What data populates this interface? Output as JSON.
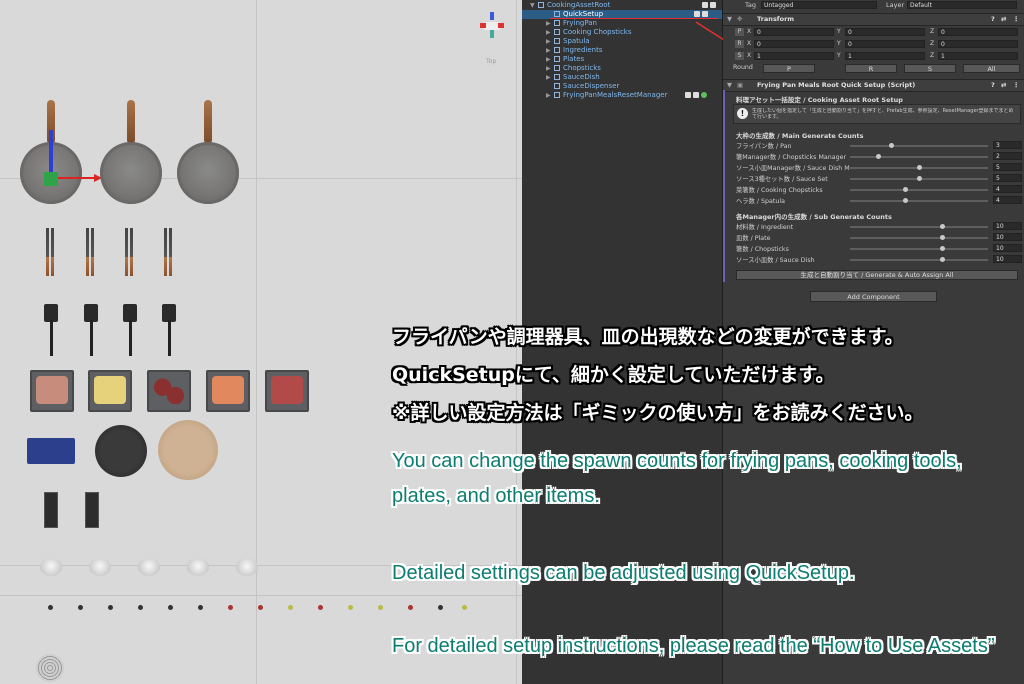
{
  "scene": {
    "gizmo_label": "Top"
  },
  "hierarchy": {
    "items": [
      {
        "label": "CookingAssetRoot"
      },
      {
        "label": "QuickSetup"
      },
      {
        "label": "FryingPan"
      },
      {
        "label": "Cooking Chopsticks"
      },
      {
        "label": "Spatula"
      },
      {
        "label": "Ingredients"
      },
      {
        "label": "Plates"
      },
      {
        "label": "Chopsticks"
      },
      {
        "label": "SauceDish"
      },
      {
        "label": "SauceDispenser"
      },
      {
        "label": "FryingPanMealsResetManager"
      }
    ]
  },
  "inspector": {
    "tag_label": "Tag",
    "tag_value": "Untagged",
    "layer_label": "Layer",
    "layer_value": "Default",
    "transform": {
      "title": "Transform",
      "rows": [
        {
          "key": "P",
          "x": "0",
          "y": "0",
          "z": "0"
        },
        {
          "key": "R",
          "x": "0",
          "y": "0",
          "z": "0"
        },
        {
          "key": "S",
          "x": "1",
          "y": "1",
          "z": "1"
        }
      ],
      "axis_x": "X",
      "axis_y": "Y",
      "axis_z": "Z",
      "round_label": "Round",
      "round_buttons": [
        "P",
        "R",
        "S",
        "All"
      ]
    },
    "script": {
      "title": "Frying Pan Meals Root Quick Setup (Script)",
      "section_root": "料理アセット一括設定 / Cooking Asset Root Setup",
      "info_text": "生成したい個を指定して「生成と自動割り当て」を押すと、Prefab生成、参照設定、ResetManager登録までまとめて行います。",
      "section_main": "大枠の生成数 / Main Generate Counts",
      "main_counts": [
        {
          "label": "フライパン数 / Pan",
          "value": 3,
          "max": 10
        },
        {
          "label": "箸Manager数 / Chopsticks Manager",
          "value": 2,
          "max": 10
        },
        {
          "label": "ソース小皿Manager数 / Sauce Dish M",
          "value": 5,
          "max": 10
        },
        {
          "label": "ソース3種セット数 / Sauce Set",
          "value": 5,
          "max": 10
        },
        {
          "label": "菜箸数 / Cooking Chopsticks",
          "value": 4,
          "max": 10
        },
        {
          "label": "ヘラ数 / Spatula",
          "value": 4,
          "max": 10
        }
      ],
      "section_sub": "各Manager内の生成数 / Sub Generate Counts",
      "sub_counts": [
        {
          "label": "材料数 / Ingredient",
          "value": 10,
          "max": 15
        },
        {
          "label": "皿数 / Plate",
          "value": 10,
          "max": 15
        },
        {
          "label": "箸数 / Chopsticks",
          "value": 10,
          "max": 15
        },
        {
          "label": "ソース小皿数 / Sauce Dish",
          "value": 10,
          "max": 15
        }
      ],
      "generate_button": "生成と自動割り当て / Generate & Auto Assign All"
    },
    "add_component": "Add Component"
  },
  "overlay": {
    "jp_lines": [
      "フライパンや調理器具、皿の出現数などの変更ができます。",
      "QuickSetupにて、細かく設定していただけます。",
      "※詳しい設定方法は「ギミックの使い方」をお読みください。"
    ],
    "en_lines": [
      "You can change the spawn counts for frying pans, cooking tools,",
      "plates, and other items.",
      "Detailed settings can be adjusted using QuickSetup.",
      "For detailed setup instructions, please read the “How to Use Assets”"
    ]
  },
  "colors": {
    "highlight_red": "#e03030",
    "selection_blue": "#2c5d87",
    "en_text_teal": "#0c7d70"
  }
}
